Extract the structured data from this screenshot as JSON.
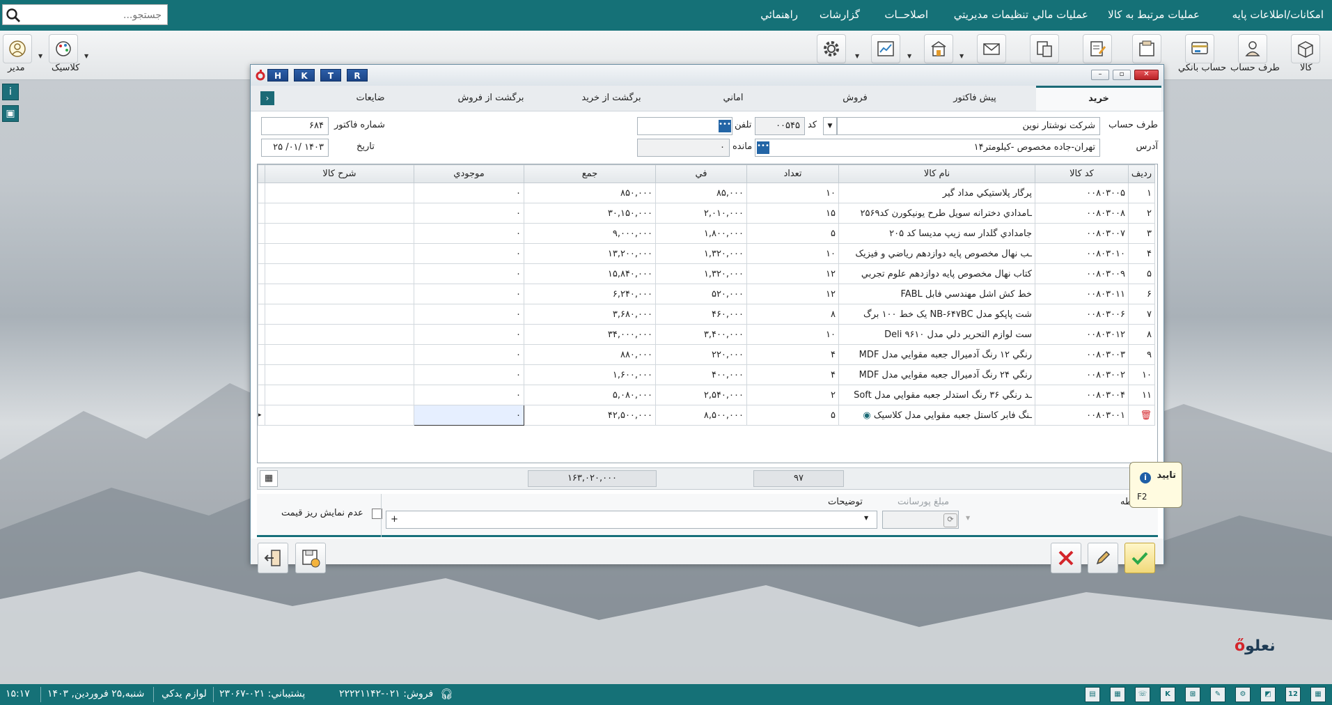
{
  "menu": {
    "items": [
      "امکانات/اطلاعات پايه",
      "عمليات مرتبط به کالا",
      "عمليات مالي",
      "تنظيمات مديريتي",
      "اصلاحــات",
      "گزارشات",
      "راهنمائي"
    ],
    "search_placeholder": "جستجو..."
  },
  "toolbar": {
    "right_labels": [
      "کالا",
      "طرف حساب",
      "حساب بانکي"
    ],
    "left_labels": [
      "کلاسيک",
      "مدير"
    ]
  },
  "window": {
    "hotkeys": [
      "H",
      "K",
      "T",
      "R"
    ],
    "tabs": [
      "خريد",
      "پيش فاکتور",
      "فروش",
      "اماني",
      "برگشت از خريد",
      "برگشت از فروش",
      "ضايعات"
    ],
    "form": {
      "account_label": "طرف حساب",
      "account_value": "شرکت نوشتار نوين",
      "code_label": "کد",
      "code_value": "۰۰۵۴۵",
      "phone_label": "تلفن",
      "phone_value": "",
      "address_label": "آدرس",
      "address_value": "تهران-جاده مخصوص -کيلومتر۱۴",
      "balance_label": "مانده",
      "balance_value": "۰",
      "invoice_label": "شماره فاکتور",
      "invoice_value": "۶۸۴",
      "date_label": "تاريخ",
      "date_value": "۱۴۰۳ /۰۱/ ۲۵"
    },
    "grid": {
      "headers": [
        "رديف",
        "کد کالا",
        "نام کالا",
        "تعداد",
        "في",
        "جمع",
        "موجودي",
        "شرح کالا"
      ],
      "rows": [
        [
          "۱",
          "۰۰۸۰۳۰۰۵",
          "پرگار پلاستيکي مداد گير",
          "۱۰",
          "۸۵,۰۰۰",
          "۸۵۰,۰۰۰",
          "۰",
          ""
        ],
        [
          "۲",
          "۰۰۸۰۳۰۰۸",
          "ـامدادي دخترانه سويل طرح يونيکورن کد۲۵۶۹",
          "۱۵",
          "۲,۰۱۰,۰۰۰",
          "۳۰,۱۵۰,۰۰۰",
          "۰",
          ""
        ],
        [
          "۳",
          "۰۰۸۰۳۰۰۷",
          "جامدادي گلدار سه زيپ مديسا کد ۲۰۵",
          "۵",
          "۱,۸۰۰,۰۰۰",
          "۹,۰۰۰,۰۰۰",
          "۰",
          ""
        ],
        [
          "۴",
          "۰۰۸۰۳۰۱۰",
          "ـب نهال مخصوص پايه دوازدهم رياضي و فيزيک",
          "۱۰",
          "۱,۳۲۰,۰۰۰",
          "۱۳,۲۰۰,۰۰۰",
          "۰",
          ""
        ],
        [
          "۵",
          "۰۰۸۰۳۰۰۹",
          "کتاب نهال مخصوص پايه دوازدهم علوم تجربي",
          "۱۲",
          "۱,۳۲۰,۰۰۰",
          "۱۵,۸۴۰,۰۰۰",
          "۰",
          ""
        ],
        [
          "۶",
          "۰۰۸۰۳۰۱۱",
          "خط کش اشل مهندسي فابل FABL",
          "۱۲",
          "۵۲۰,۰۰۰",
          "۶,۲۴۰,۰۰۰",
          "۰",
          ""
        ],
        [
          "۷",
          "۰۰۸۰۳۰۰۶",
          "شت پاپکو مدل NB-۶۴۷BC يک خط ۱۰۰ برگ",
          "۸",
          "۴۶۰,۰۰۰",
          "۳,۶۸۰,۰۰۰",
          "۰",
          ""
        ],
        [
          "۸",
          "۰۰۸۰۳۰۱۲",
          "ست لوازم التحرير دلي مدل Deli ۹۶۱۰",
          "۱۰",
          "۳,۴۰۰,۰۰۰",
          "۳۴,۰۰۰,۰۰۰",
          "۰",
          ""
        ],
        [
          "۹",
          "۰۰۸۰۳۰۰۳",
          "رنگي ۱۲ رنگ آدميرال جعبه مقوايي مدل MDF",
          "۴",
          "۲۲۰,۰۰۰",
          "۸۸۰,۰۰۰",
          "۰",
          ""
        ],
        [
          "۱۰",
          "۰۰۸۰۳۰۰۲",
          "رنگي ۲۴ رنگ آدميرال جعبه مقوايي مدل MDF",
          "۴",
          "۴۰۰,۰۰۰",
          "۱,۶۰۰,۰۰۰",
          "۰",
          ""
        ],
        [
          "۱۱",
          "۰۰۸۰۳۰۰۴",
          "ـد رنگي ۳۶ رنگ استدلر جعبه مقوايي مدل Soft",
          "۲",
          "۲,۵۴۰,۰۰۰",
          "۵,۰۸۰,۰۰۰",
          "۰",
          ""
        ],
        [
          "",
          "۰۰۸۰۳۰۰۱",
          "ـنگ فابر کاستل جعبه مقوايي مدل کلاسيک",
          "۵",
          "۸,۵۰۰,۰۰۰",
          "۴۲,۵۰۰,۰۰۰",
          "۰",
          ""
        ]
      ],
      "total_qty": "۹۷",
      "total_sum": "۱۶۳,۰۲۰,۰۰۰"
    },
    "bottom": {
      "desc_label": "توضيحات",
      "desc_value": "+",
      "porsant_label": "مبلغ پورسانت",
      "hide_price_label": "عدم نمايش ريز قيمت",
      "partial_label": "طه"
    },
    "tooltip": {
      "title": "تاييد",
      "key": "F2"
    }
  },
  "status": {
    "time": "۱۵:۱۷",
    "date": "شنبه,۲۵ فروردين, ۱۴۰۳",
    "store": "لوازم يدکي",
    "support": "پشتيباني: ۰۲۱-۲۳۰۶۷",
    "sales": "فروش: ۰۲۱-۲۲۲۲۱۱۴۲"
  },
  "logo_text": "نعلو",
  "colors": {
    "primary": "#157177",
    "confirm": "#2da84a",
    "cancel": "#d4252b",
    "hotkey": "#1b4587"
  }
}
